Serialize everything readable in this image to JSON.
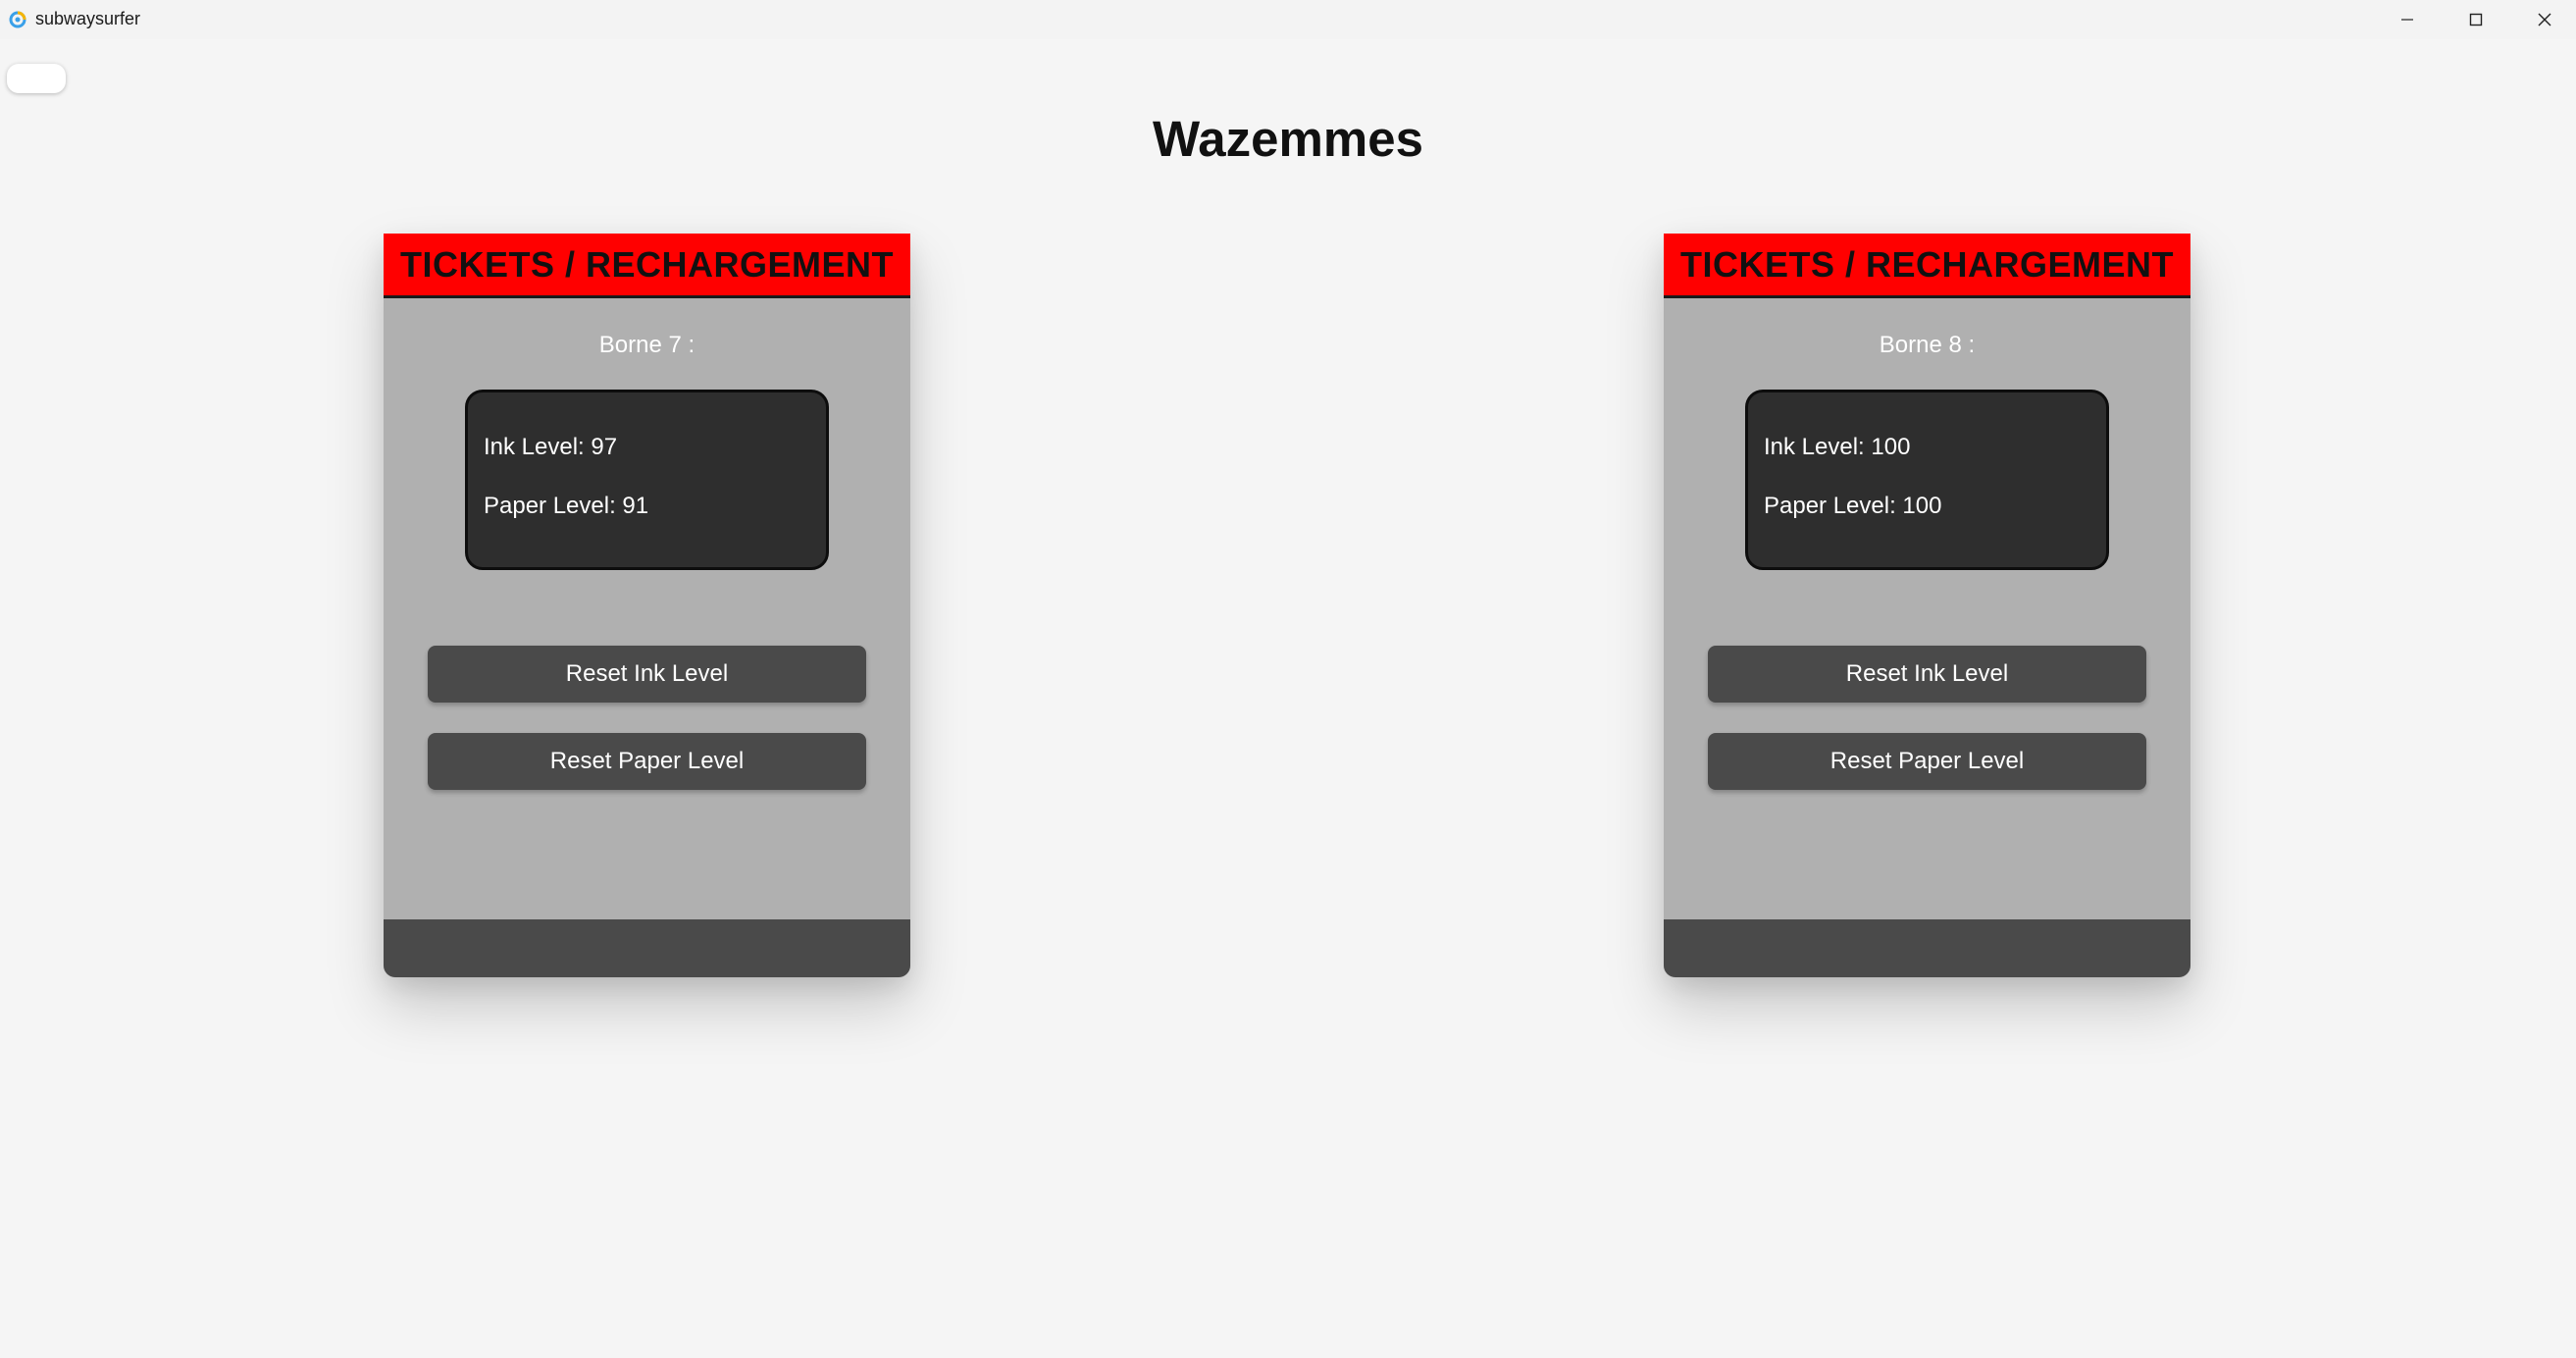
{
  "window": {
    "app_title": "subwaysurfer",
    "icon": "app-logo-icon",
    "controls": {
      "minimize_icon": "minimize-icon",
      "maximize_icon": "maximize-icon",
      "close_icon": "close-icon"
    }
  },
  "page": {
    "station_name": "Wazemmes"
  },
  "kiosks": [
    {
      "header": "TICKETS / RECHARGEMENT",
      "label": "Borne 7 :",
      "ink_level_text": "Ink Level: 97",
      "paper_level_text": "Paper Level: 91",
      "reset_ink_label": "Reset Ink Level",
      "reset_paper_label": "Reset Paper Level"
    },
    {
      "header": "TICKETS / RECHARGEMENT",
      "label": "Borne 8 :",
      "ink_level_text": "Ink Level: 100",
      "paper_level_text": "Paper Level: 100",
      "reset_ink_label": "Reset Ink Level",
      "reset_paper_label": "Reset Paper Level"
    }
  ],
  "colors": {
    "header_red": "#ff0000",
    "kiosk_body": "#b0b0b0",
    "panel_dark": "#2e2e2e",
    "button_dark": "#4a4a4a",
    "page_bg": "#f5f5f5"
  }
}
